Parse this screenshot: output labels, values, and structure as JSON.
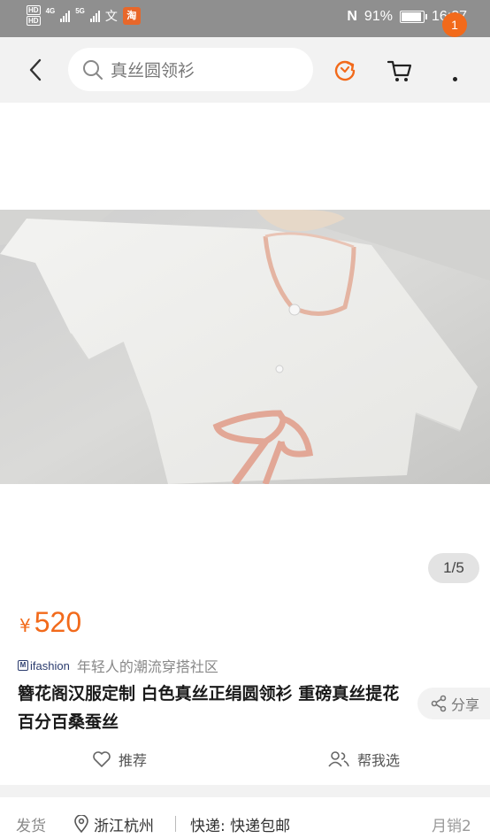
{
  "status_bar": {
    "hd1": "HD",
    "hd2": "HD",
    "net1": "4G",
    "net2": "5G",
    "wen": "文",
    "taobao_badge": "淘",
    "nfc": "N",
    "battery": "91%",
    "time": "16:27",
    "battery_level": 0.91
  },
  "header": {
    "search_text": "真丝圆领衫",
    "cart_badge": "1"
  },
  "gallery": {
    "counter": "1/5"
  },
  "product": {
    "currency": "¥",
    "price": "520",
    "ifashion_logo": "ifashion",
    "ifashion_tagline": "年轻人的潮流穿搭社区",
    "title": "簪花阁汉服定制 白色真丝正绢圆领衫 重磅真丝提花百分百桑蚕丝",
    "share_label": "分享"
  },
  "actions": {
    "recommend": "推荐",
    "help_choose": "帮我选"
  },
  "shipping": {
    "label": "发货",
    "location": "浙江杭州",
    "express": "快递: 快递包邮",
    "sales": "月销2"
  },
  "colors": {
    "accent": "#f26a1b",
    "header_bg": "#f2f2f2",
    "status_bg": "#8f8f8f"
  }
}
